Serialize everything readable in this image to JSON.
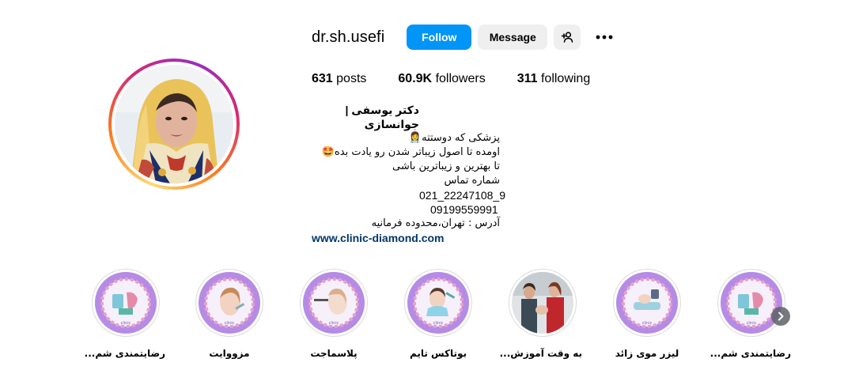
{
  "profile": {
    "username": "dr.sh.usefi",
    "follow_label": "Follow",
    "message_label": "Message",
    "stats": {
      "posts_count": "631",
      "posts_label": "posts",
      "followers_count": "60.9K",
      "followers_label": "followers",
      "following_count": "311",
      "following_label": "following"
    },
    "bio": {
      "name": "دکتر یوسفی | جوانسازی",
      "lines": [
        "پزشکی که دوستته👩‍⚕️",
        "اومده تا اصول زیباتر شدن رو یادت بده🤩",
        "تا بهترین و زیباترین باشی",
        "شماره تماس",
        "021_22247108_9",
        "09199559991",
        "آدرس : تهران،محدوده فرمانیه"
      ],
      "link": "www.clinic-diamond.com"
    }
  },
  "highlights": [
    {
      "label": "رضایتمندی شم...",
      "icon": "satisfaction-highlight"
    },
    {
      "label": "مزووایت",
      "icon": "mesowhite-highlight"
    },
    {
      "label": "پلاسماجت",
      "icon": "plasmajet-highlight"
    },
    {
      "label": "بوتاکس تایم",
      "icon": "botox-highlight"
    },
    {
      "label": "به وقت آموزش...",
      "icon": "training-highlight"
    },
    {
      "label": "لیزر موی زائد",
      "icon": "laser-highlight"
    },
    {
      "label": "رضایتمندی شم...",
      "icon": "satisfaction-highlight"
    }
  ],
  "colors": {
    "follow_button": "#0095f6",
    "secondary_button": "#efefef",
    "link": "#00376b",
    "highlight_bg": "#b58be6"
  },
  "icons": {
    "add_person": "add-person-icon",
    "more": "more-options-icon",
    "next": "chevron-right-icon"
  }
}
